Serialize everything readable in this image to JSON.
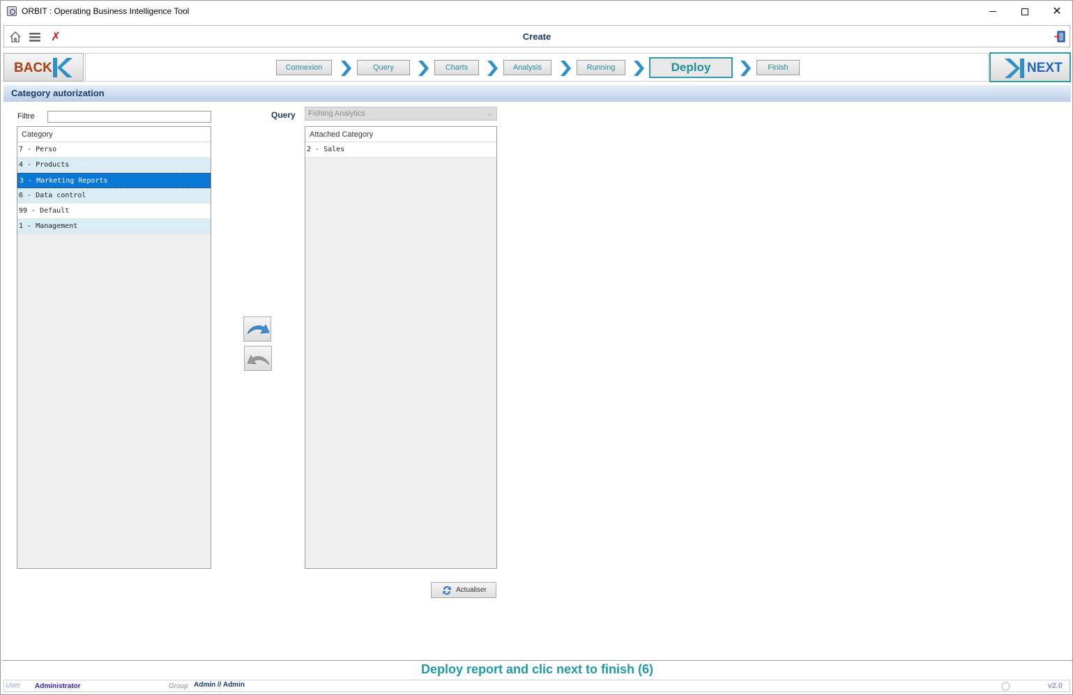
{
  "window": {
    "title": "ORBIT : Operating Business Intelligence Tool"
  },
  "toolbar": {
    "title": "Create",
    "icons": [
      "home-icon",
      "menu-icon",
      "close-icon",
      "exit-icon"
    ]
  },
  "wizard": {
    "back_label": "BACK",
    "next_label": "NEXT",
    "steps": [
      {
        "label": "Connexion",
        "active": false
      },
      {
        "label": "Query",
        "active": false
      },
      {
        "label": "Charts",
        "active": false
      },
      {
        "label": "Analysis",
        "active": false
      },
      {
        "label": "Running",
        "active": false
      },
      {
        "label": "Deploy",
        "active": true
      },
      {
        "label": "Finish",
        "active": false
      }
    ]
  },
  "section": {
    "title": "Category autorization"
  },
  "filter": {
    "label": "Filtre",
    "value": ""
  },
  "category_list": {
    "header": "Category",
    "items": [
      {
        "label": "7 - Perso"
      },
      {
        "label": "4 - Products"
      },
      {
        "label": "3 - Marketing Reports",
        "selected": true
      },
      {
        "label": "6 - Data control"
      },
      {
        "label": "99 - Default"
      },
      {
        "label": "1 - Management"
      }
    ]
  },
  "query": {
    "label": "Query",
    "selected": "Fishing Analytics"
  },
  "attached_list": {
    "header": "Attached Category",
    "items": [
      {
        "label": "2 - Sales"
      }
    ]
  },
  "refresh": {
    "label": "Actualiser"
  },
  "hint": "Deploy report and clic next to finish (6)",
  "status": {
    "user_label": "User",
    "user": "Administrator",
    "group_label": "Group",
    "group": "Admin // Admin",
    "version": "v2.0"
  },
  "colors": {
    "accent": "#2e9aa8",
    "selection": "#0a78d7",
    "row_alt": "#daedf4",
    "back": "#b03d10",
    "next": "#1f66c2"
  }
}
